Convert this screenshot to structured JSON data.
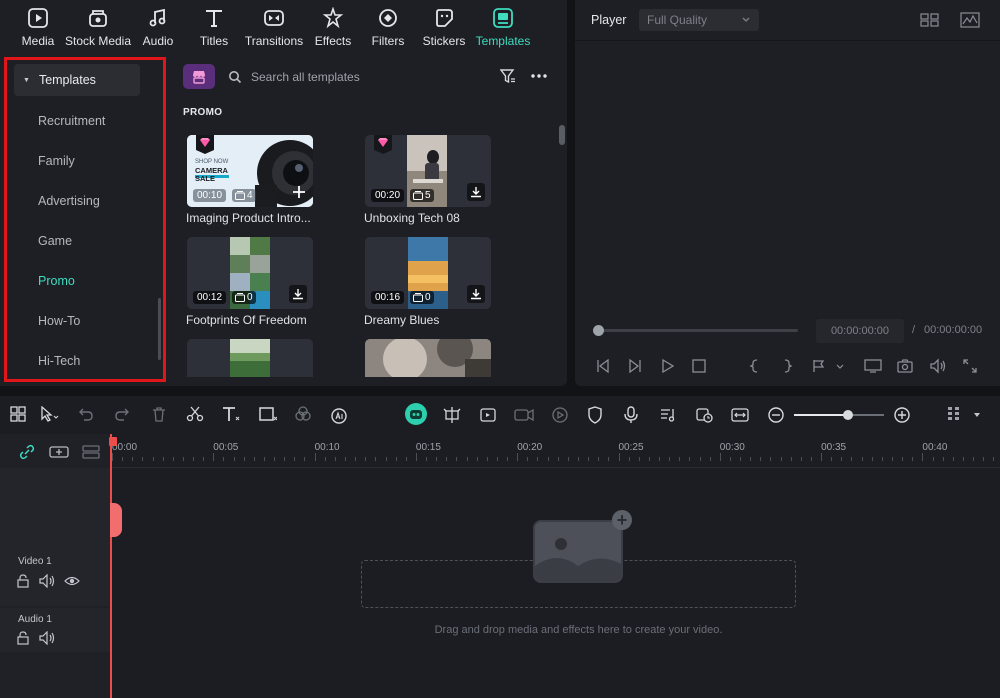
{
  "tabs": [
    {
      "label": "Media",
      "icon": "media-icon"
    },
    {
      "label": "Stock Media",
      "icon": "stock-media-icon"
    },
    {
      "label": "Audio",
      "icon": "audio-icon"
    },
    {
      "label": "Titles",
      "icon": "titles-icon"
    },
    {
      "label": "Transitions",
      "icon": "transitions-icon"
    },
    {
      "label": "Effects",
      "icon": "effects-icon"
    },
    {
      "label": "Filters",
      "icon": "filters-icon"
    },
    {
      "label": "Stickers",
      "icon": "stickers-icon"
    },
    {
      "label": "Templates",
      "icon": "templates-icon",
      "active": true
    }
  ],
  "sidebar": {
    "header": "Templates",
    "items": [
      "Recruitment",
      "Family",
      "Advertising",
      "Game",
      "Promo",
      "How-To",
      "Hi-Tech"
    ],
    "active": "Promo"
  },
  "search": {
    "placeholder": "Search all templates"
  },
  "section": "PROMO",
  "cards": [
    {
      "title": "Imaging Product Intro...",
      "duration": "00:10",
      "count": "4",
      "premium": true
    },
    {
      "title": "Unboxing Tech 08",
      "duration": "00:20",
      "count": "5",
      "premium": true
    },
    {
      "title": "Footprints Of Freedom",
      "duration": "00:12",
      "count": "0",
      "premium": false
    },
    {
      "title": "Dreamy Blues",
      "duration": "00:16",
      "count": "0",
      "premium": false
    }
  ],
  "thumb_text": {
    "line1": "SHOP NOW",
    "line2": "CAMERA",
    "line3": "SALE"
  },
  "player": {
    "label": "Player",
    "quality": "Full Quality",
    "current_time": "00:00:00:00",
    "separator": "/",
    "total_time": "00:00:00:00"
  },
  "timeline": {
    "ruler": [
      "00:00",
      "00:05",
      "00:10",
      "00:15",
      "00:20",
      "00:25",
      "00:30",
      "00:35",
      "00:40"
    ],
    "tracks": [
      {
        "name": "Video 1"
      },
      {
        "name": "Audio 1"
      }
    ],
    "drop_text": "Drag and drop media and effects here to create your video.",
    "zoom": 0.6
  },
  "colors": {
    "accent": "#3fdcc0",
    "playhead": "#ef4c4c",
    "highlight": "#e0161a"
  }
}
